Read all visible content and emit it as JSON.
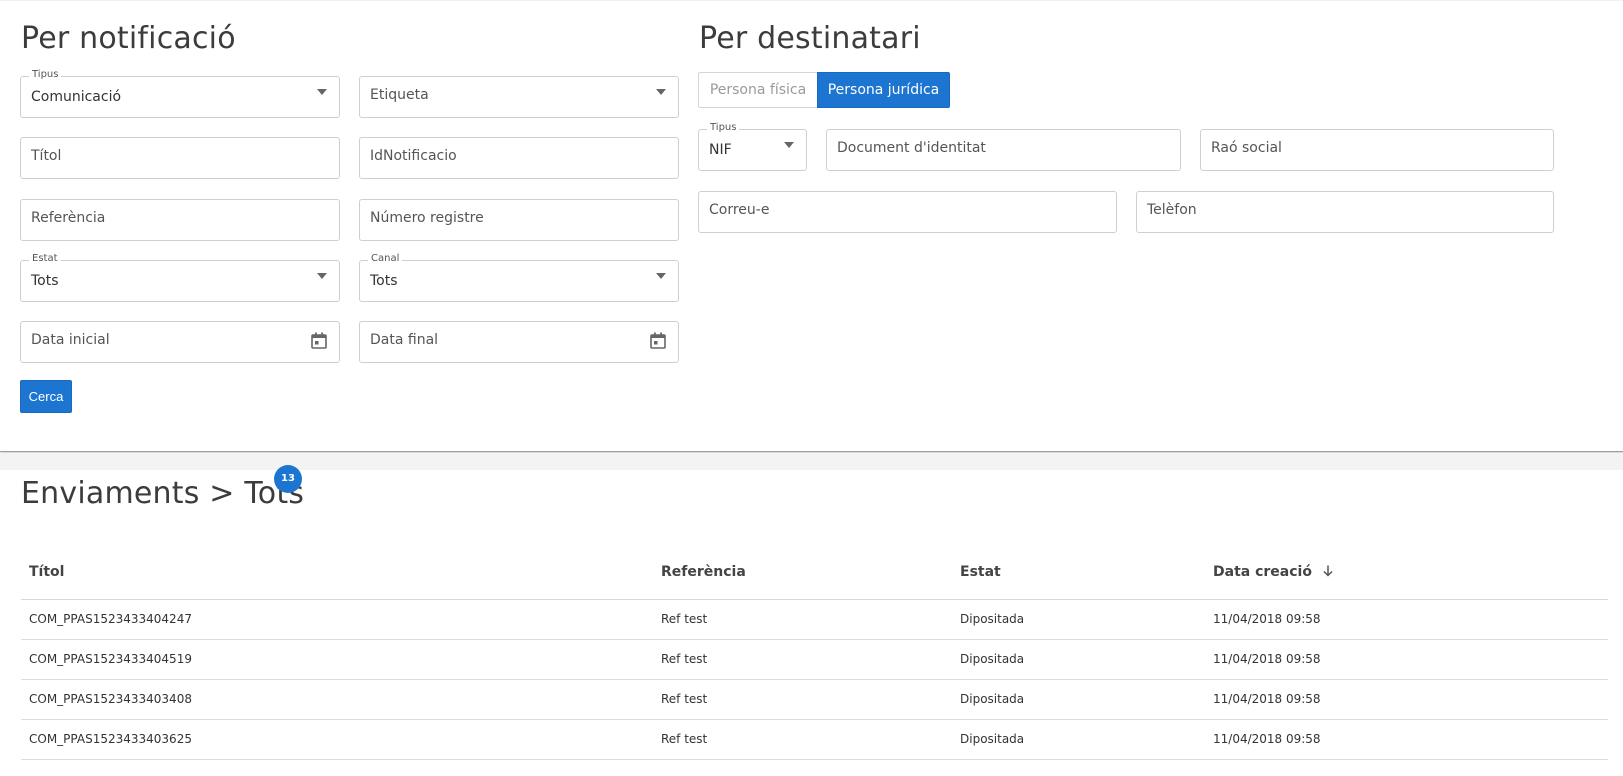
{
  "notification_filter": {
    "title": "Per notificació",
    "tipus": {
      "legend": "Tipus",
      "value": "Comunicació"
    },
    "etiqueta": {
      "placeholder": "Etiqueta"
    },
    "titol": {
      "placeholder": "Títol"
    },
    "id_notificacio": {
      "placeholder": "IdNotificacio"
    },
    "referencia": {
      "placeholder": "Referència"
    },
    "numero_registre": {
      "placeholder": "Número registre"
    },
    "estat": {
      "legend": "Estat",
      "value": "Tots"
    },
    "canal": {
      "legend": "Canal",
      "value": "Tots"
    },
    "data_inicial": {
      "placeholder": "Data inicial"
    },
    "data_final": {
      "placeholder": "Data final"
    },
    "search_label": "Cerca"
  },
  "recipient_filter": {
    "title": "Per destinatari",
    "toggle": {
      "option_1": "Persona física",
      "option_2": "Persona jurídica",
      "selected": "Persona jurídica"
    },
    "tipus": {
      "legend": "Tipus",
      "value": "NIF"
    },
    "document": {
      "placeholder": "Document d'identitat"
    },
    "rao_social": {
      "placeholder": "Raó social"
    },
    "correu": {
      "placeholder": "Correu-e"
    },
    "telefon": {
      "placeholder": "Telèfon"
    }
  },
  "results": {
    "title": "Enviaments > Tots",
    "count": "13",
    "columns": {
      "titol": "Títol",
      "referencia": "Referència",
      "estat": "Estat",
      "data_creacio": "Data creació"
    },
    "sort_icon": "arrow-down-icon",
    "rows": [
      {
        "titol": "COM_PPAS1523433404247",
        "referencia": "Ref test",
        "estat": "Dipositada",
        "data": "11/04/2018 09:58"
      },
      {
        "titol": "COM_PPAS1523433404519",
        "referencia": "Ref test",
        "estat": "Dipositada",
        "data": "11/04/2018 09:58"
      },
      {
        "titol": "COM_PPAS1523433403408",
        "referencia": "Ref test",
        "estat": "Dipositada",
        "data": "11/04/2018 09:58"
      },
      {
        "titol": "COM_PPAS1523433403625",
        "referencia": "Ref test",
        "estat": "Dipositada",
        "data": "11/04/2018 09:58"
      }
    ]
  },
  "colors": {
    "primary": "#1d75d2"
  }
}
